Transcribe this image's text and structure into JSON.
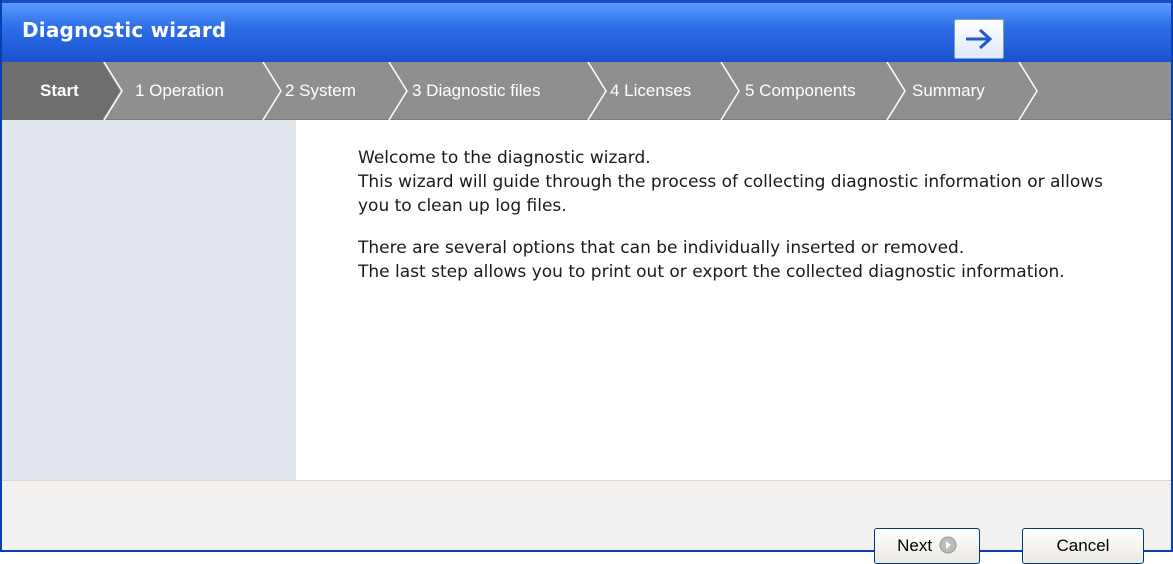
{
  "window": {
    "title": "Diagnostic wizard"
  },
  "colors": {
    "titlebar": "#2d6fe8",
    "stepbar": "#8f8f8f",
    "active_step": "#6e6e6e",
    "sidepanel": "#e3e8ee"
  },
  "steps": [
    {
      "label": "Start",
      "active": true
    },
    {
      "label": "1 Operation"
    },
    {
      "label": "2 System"
    },
    {
      "label": "3 Diagnostic files"
    },
    {
      "label": "4 Licenses"
    },
    {
      "label": "5 Components"
    },
    {
      "label": "Summary"
    }
  ],
  "content": {
    "lines": [
      "Welcome to the diagnostic wizard.",
      "This wizard will guide through the process of collecting diagnostic information or allows",
      "you to clean up log files.",
      "There are several options that can be individually inserted or removed.",
      "The last step allows you to print out or export the collected diagnostic information."
    ]
  },
  "buttons": {
    "next": "Next",
    "cancel": "Cancel"
  }
}
